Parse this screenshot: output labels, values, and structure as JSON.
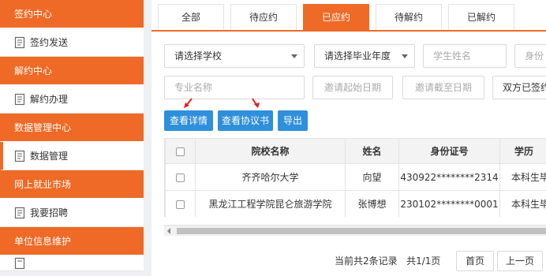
{
  "sidebar": {
    "sections": [
      {
        "header": "签约中心",
        "items": [
          "签约发送"
        ]
      },
      {
        "header": "解约中心",
        "items": [
          "解约办理"
        ]
      },
      {
        "header": "数据管理中心",
        "items": [
          "数据管理"
        ]
      },
      {
        "header": "网上就业市场",
        "items": [
          "我要招聘"
        ]
      },
      {
        "header": "单位信息维护",
        "items": []
      }
    ]
  },
  "tabs": [
    "全部",
    "待应约",
    "已应约",
    "待解约",
    "已解约"
  ],
  "active_tab": "已应约",
  "filters": {
    "school_select": "请选择学校",
    "year_select": "请选择毕业年度",
    "student_name_ph": "学生姓名",
    "id_ph": "身份",
    "major_ph": "专业名称",
    "start_date_ph": "邀请起始日期",
    "end_date_ph": "邀请截至日期",
    "status_select": "双方已签约"
  },
  "actions": {
    "view_detail": "查看详情",
    "view_agreement": "查看协议书",
    "export": "导出"
  },
  "table": {
    "headers": [
      "院校名称",
      "姓名",
      "身份证号",
      "学历"
    ],
    "rows": [
      [
        "齐齐哈尔大学",
        "向望",
        "430922********2314",
        "本科生毕业"
      ],
      [
        "黑龙江工程学院昆仑旅游学院",
        "张博想",
        "230102********0001",
        "本科生毕业"
      ]
    ]
  },
  "pager": {
    "summary": "当前共2条记录   共1/1页",
    "first": "首页",
    "prev": "上一页"
  },
  "colors": {
    "accent": "#ee6a26",
    "button": "#2e8fdb",
    "arrow": "#e2231a"
  }
}
